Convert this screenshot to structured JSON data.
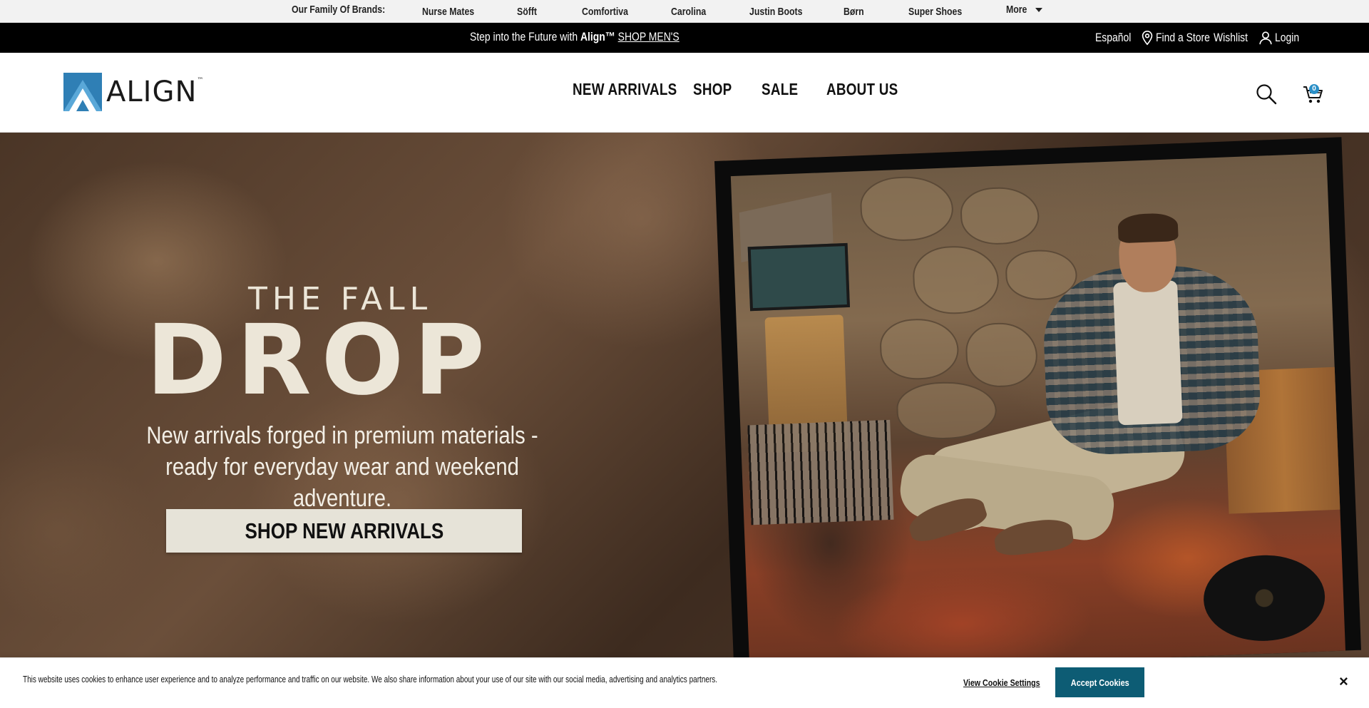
{
  "brandbar": {
    "label": "Our Family Of Brands:",
    "brands": [
      "Nurse Mates",
      "Söfft",
      "Comfortiva",
      "Carolina",
      "Justin Boots",
      "Børn",
      "Super Shoes"
    ],
    "more_label": "More"
  },
  "promobar": {
    "text_prefix": "Step into the Future with ",
    "text_brand": "Align™",
    "text_link": "SHOP MEN'S",
    "language": "Español",
    "find_store": "Find a Store",
    "wishlist": "Wishlist",
    "login": "Login"
  },
  "header": {
    "logo_text": "ALIGN",
    "logo_tm": "™",
    "nav": [
      "NEW ARRIVALS",
      "SHOP",
      "SALE",
      "ABOUT US"
    ],
    "cart_count": "0",
    "icons": [
      "search-icon",
      "cart-icon"
    ]
  },
  "hero": {
    "kicker": "THE FALL",
    "title": "DROP",
    "subtitle": "New arrivals forged in premium materials - ready for everyday wear and weekend adventure.",
    "cta": "SHOP NEW ARRIVALS"
  },
  "cookie": {
    "text": "This website uses cookies to enhance user experience and to analyze performance and traffic on our website. We also share information about your use of our site with our social media, advertising and analytics partners.",
    "settings_label": "View Cookie Settings",
    "accept_label": "Accept Cookies",
    "close_label": "×"
  },
  "colors": {
    "promo_bg": "#000000",
    "accept_button": "#0d5c74",
    "cart_badge": "#2a8fc7",
    "hero_text": "#ece6d8",
    "cta_bg": "#e6e3d8"
  }
}
